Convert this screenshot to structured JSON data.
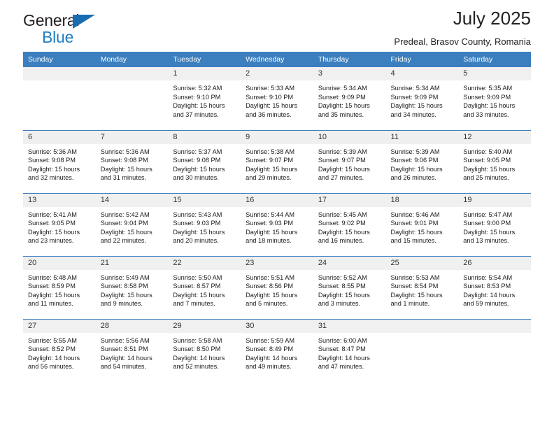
{
  "brand": {
    "name_top": "General",
    "name_bottom": "Blue",
    "triangle_color": "#1a6cb0",
    "blue_color": "#1f7ec4",
    "dark_color": "#231f20"
  },
  "header": {
    "title": "July 2025",
    "subtitle": "Predeal, Brasov County, Romania"
  },
  "theme": {
    "header_bar": "#3b7fbe",
    "daynum_bg": "#f0f0f0",
    "text": "#1a1a1a",
    "page_bg": "#ffffff"
  },
  "calendar": {
    "weekday_headers": [
      "Sunday",
      "Monday",
      "Tuesday",
      "Wednesday",
      "Thursday",
      "Friday",
      "Saturday"
    ],
    "weeks": [
      [
        {
          "day": "",
          "blank": true,
          "sunrise": "",
          "sunset": "",
          "daylight": ""
        },
        {
          "day": "",
          "blank": true,
          "sunrise": "",
          "sunset": "",
          "daylight": ""
        },
        {
          "day": "1",
          "blank": false,
          "sunrise": "Sunrise: 5:32 AM",
          "sunset": "Sunset: 9:10 PM",
          "daylight": "Daylight: 15 hours and 37 minutes."
        },
        {
          "day": "2",
          "blank": false,
          "sunrise": "Sunrise: 5:33 AM",
          "sunset": "Sunset: 9:10 PM",
          "daylight": "Daylight: 15 hours and 36 minutes."
        },
        {
          "day": "3",
          "blank": false,
          "sunrise": "Sunrise: 5:34 AM",
          "sunset": "Sunset: 9:09 PM",
          "daylight": "Daylight: 15 hours and 35 minutes."
        },
        {
          "day": "4",
          "blank": false,
          "sunrise": "Sunrise: 5:34 AM",
          "sunset": "Sunset: 9:09 PM",
          "daylight": "Daylight: 15 hours and 34 minutes."
        },
        {
          "day": "5",
          "blank": false,
          "sunrise": "Sunrise: 5:35 AM",
          "sunset": "Sunset: 9:09 PM",
          "daylight": "Daylight: 15 hours and 33 minutes."
        }
      ],
      [
        {
          "day": "6",
          "blank": false,
          "sunrise": "Sunrise: 5:36 AM",
          "sunset": "Sunset: 9:08 PM",
          "daylight": "Daylight: 15 hours and 32 minutes."
        },
        {
          "day": "7",
          "blank": false,
          "sunrise": "Sunrise: 5:36 AM",
          "sunset": "Sunset: 9:08 PM",
          "daylight": "Daylight: 15 hours and 31 minutes."
        },
        {
          "day": "8",
          "blank": false,
          "sunrise": "Sunrise: 5:37 AM",
          "sunset": "Sunset: 9:08 PM",
          "daylight": "Daylight: 15 hours and 30 minutes."
        },
        {
          "day": "9",
          "blank": false,
          "sunrise": "Sunrise: 5:38 AM",
          "sunset": "Sunset: 9:07 PM",
          "daylight": "Daylight: 15 hours and 29 minutes."
        },
        {
          "day": "10",
          "blank": false,
          "sunrise": "Sunrise: 5:39 AM",
          "sunset": "Sunset: 9:07 PM",
          "daylight": "Daylight: 15 hours and 27 minutes."
        },
        {
          "day": "11",
          "blank": false,
          "sunrise": "Sunrise: 5:39 AM",
          "sunset": "Sunset: 9:06 PM",
          "daylight": "Daylight: 15 hours and 26 minutes."
        },
        {
          "day": "12",
          "blank": false,
          "sunrise": "Sunrise: 5:40 AM",
          "sunset": "Sunset: 9:05 PM",
          "daylight": "Daylight: 15 hours and 25 minutes."
        }
      ],
      [
        {
          "day": "13",
          "blank": false,
          "sunrise": "Sunrise: 5:41 AM",
          "sunset": "Sunset: 9:05 PM",
          "daylight": "Daylight: 15 hours and 23 minutes."
        },
        {
          "day": "14",
          "blank": false,
          "sunrise": "Sunrise: 5:42 AM",
          "sunset": "Sunset: 9:04 PM",
          "daylight": "Daylight: 15 hours and 22 minutes."
        },
        {
          "day": "15",
          "blank": false,
          "sunrise": "Sunrise: 5:43 AM",
          "sunset": "Sunset: 9:03 PM",
          "daylight": "Daylight: 15 hours and 20 minutes."
        },
        {
          "day": "16",
          "blank": false,
          "sunrise": "Sunrise: 5:44 AM",
          "sunset": "Sunset: 9:03 PM",
          "daylight": "Daylight: 15 hours and 18 minutes."
        },
        {
          "day": "17",
          "blank": false,
          "sunrise": "Sunrise: 5:45 AM",
          "sunset": "Sunset: 9:02 PM",
          "daylight": "Daylight: 15 hours and 16 minutes."
        },
        {
          "day": "18",
          "blank": false,
          "sunrise": "Sunrise: 5:46 AM",
          "sunset": "Sunset: 9:01 PM",
          "daylight": "Daylight: 15 hours and 15 minutes."
        },
        {
          "day": "19",
          "blank": false,
          "sunrise": "Sunrise: 5:47 AM",
          "sunset": "Sunset: 9:00 PM",
          "daylight": "Daylight: 15 hours and 13 minutes."
        }
      ],
      [
        {
          "day": "20",
          "blank": false,
          "sunrise": "Sunrise: 5:48 AM",
          "sunset": "Sunset: 8:59 PM",
          "daylight": "Daylight: 15 hours and 11 minutes."
        },
        {
          "day": "21",
          "blank": false,
          "sunrise": "Sunrise: 5:49 AM",
          "sunset": "Sunset: 8:58 PM",
          "daylight": "Daylight: 15 hours and 9 minutes."
        },
        {
          "day": "22",
          "blank": false,
          "sunrise": "Sunrise: 5:50 AM",
          "sunset": "Sunset: 8:57 PM",
          "daylight": "Daylight: 15 hours and 7 minutes."
        },
        {
          "day": "23",
          "blank": false,
          "sunrise": "Sunrise: 5:51 AM",
          "sunset": "Sunset: 8:56 PM",
          "daylight": "Daylight: 15 hours and 5 minutes."
        },
        {
          "day": "24",
          "blank": false,
          "sunrise": "Sunrise: 5:52 AM",
          "sunset": "Sunset: 8:55 PM",
          "daylight": "Daylight: 15 hours and 3 minutes."
        },
        {
          "day": "25",
          "blank": false,
          "sunrise": "Sunrise: 5:53 AM",
          "sunset": "Sunset: 8:54 PM",
          "daylight": "Daylight: 15 hours and 1 minute."
        },
        {
          "day": "26",
          "blank": false,
          "sunrise": "Sunrise: 5:54 AM",
          "sunset": "Sunset: 8:53 PM",
          "daylight": "Daylight: 14 hours and 59 minutes."
        }
      ],
      [
        {
          "day": "27",
          "blank": false,
          "sunrise": "Sunrise: 5:55 AM",
          "sunset": "Sunset: 8:52 PM",
          "daylight": "Daylight: 14 hours and 56 minutes."
        },
        {
          "day": "28",
          "blank": false,
          "sunrise": "Sunrise: 5:56 AM",
          "sunset": "Sunset: 8:51 PM",
          "daylight": "Daylight: 14 hours and 54 minutes."
        },
        {
          "day": "29",
          "blank": false,
          "sunrise": "Sunrise: 5:58 AM",
          "sunset": "Sunset: 8:50 PM",
          "daylight": "Daylight: 14 hours and 52 minutes."
        },
        {
          "day": "30",
          "blank": false,
          "sunrise": "Sunrise: 5:59 AM",
          "sunset": "Sunset: 8:49 PM",
          "daylight": "Daylight: 14 hours and 49 minutes."
        },
        {
          "day": "31",
          "blank": false,
          "sunrise": "Sunrise: 6:00 AM",
          "sunset": "Sunset: 8:47 PM",
          "daylight": "Daylight: 14 hours and 47 minutes."
        },
        {
          "day": "",
          "blank": true,
          "sunrise": "",
          "sunset": "",
          "daylight": ""
        },
        {
          "day": "",
          "blank": true,
          "sunrise": "",
          "sunset": "",
          "daylight": ""
        }
      ]
    ]
  }
}
